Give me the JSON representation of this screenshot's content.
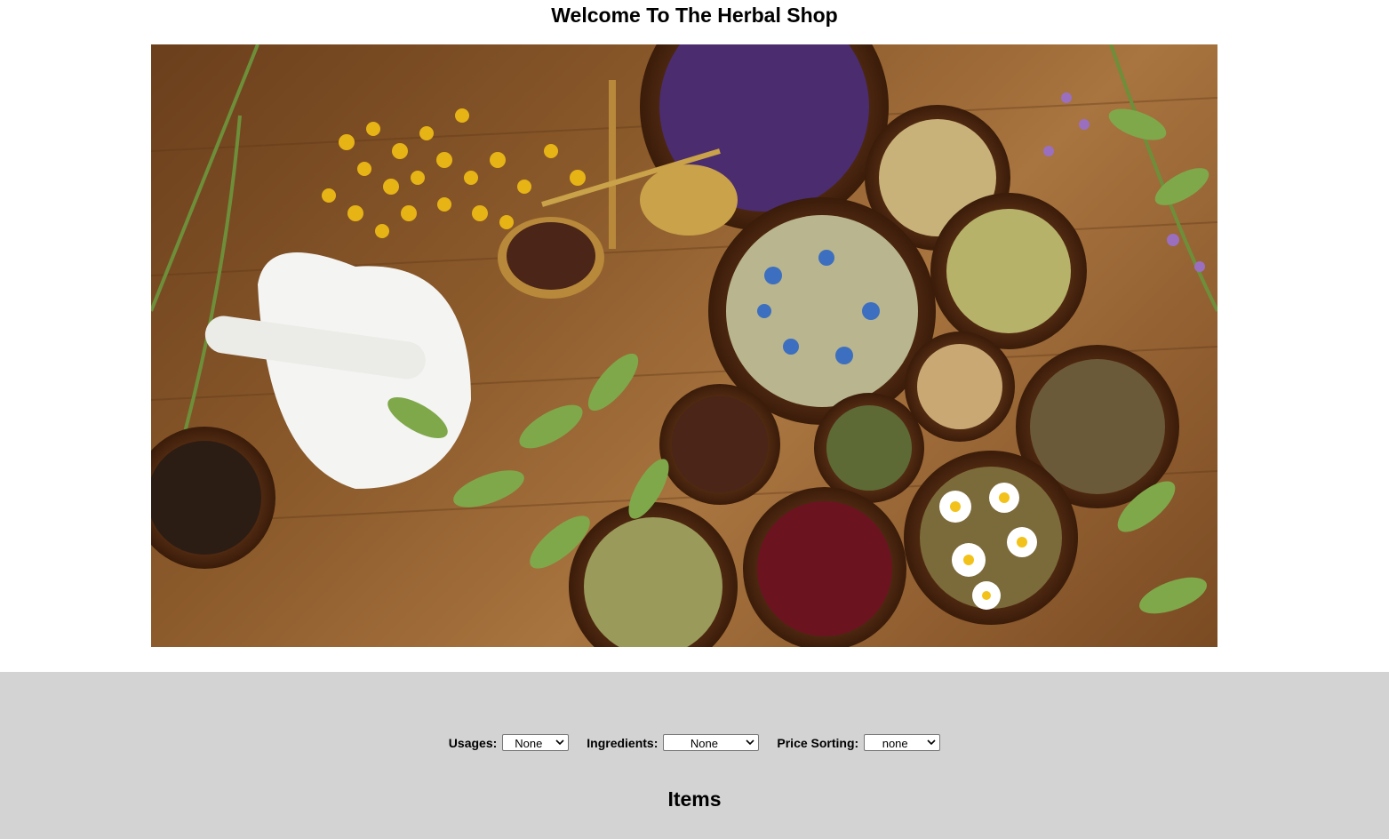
{
  "header": {
    "title": "Welcome To The Herbal Shop"
  },
  "hero_image": {
    "icon": "herbal-banner-image"
  },
  "filters": {
    "usages": {
      "label": "Usages:",
      "selected": "None"
    },
    "ingredients": {
      "label": "Ingredients:",
      "selected": "None"
    },
    "price_sorting": {
      "label": "Price Sorting:",
      "selected": "none"
    }
  },
  "items": {
    "heading": "Items"
  },
  "colors": {
    "filter_background": "#d3d3d3",
    "page_background": "#ffffff"
  }
}
